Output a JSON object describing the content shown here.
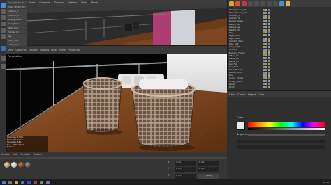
{
  "app": {
    "name": "CINEMA 4D"
  },
  "viewport_top": {
    "tabs": [
      "View",
      "Cameras",
      "Display",
      "Options",
      "Filter",
      "Panel"
    ]
  },
  "mid_toolbar": {
    "items": [
      "View",
      "Cameras",
      "Display",
      "Options",
      "Filter",
      "Panel",
      "ProRender"
    ]
  },
  "render_view": {
    "label": "Perspective"
  },
  "status_overlay": {
    "lines": [
      "Progress: 100%",
      "Time: 00:02:15",
      "Samples: 512",
      "Res: 1920x1080",
      "Frame 0"
    ]
  },
  "object_manager": {
    "toolbar_colors": [
      "#d6a03c",
      "#d45a2a",
      "#c23b3b",
      "#8a8a8a",
      "#4a8fd6"
    ],
    "rows": [
      "Chair_Wicker_01",
      "Chair_Wicker_02",
      "Cushion_L",
      "Cushion_R",
      "Railing_Glass",
      "Deck_Floor",
      "Table_Low",
      "Planter_01",
      "Sky",
      "Light_Sun",
      "Light_Area",
      "Camera_Main",
      "Wall_Left",
      "Wall_Right",
      "Ground",
      "Balcony_Frame",
      "Pillow_01",
      "Pillow_02",
      "Pillow_03",
      "Rail_Top",
      "Rail_Post",
      "Floor_Boards",
      "Background",
      "Env",
      "Group_Chairs",
      "Group_Deco",
      "Lamp",
      "HDRI"
    ]
  },
  "attributes": {
    "tabs": [
      "Basic",
      "Coord.",
      "Object",
      "Color"
    ],
    "color_label": "Color",
    "brightness_label": "Brightness",
    "swatch_color": "#e8e8e8"
  },
  "bottom_panel": {
    "menu": [
      "Create",
      "Edit",
      "Function",
      "Texture"
    ],
    "coord_labels": [
      "X",
      "Y",
      "Z"
    ],
    "coord_values": [
      "0 cm",
      "0 cm",
      "0 cm"
    ],
    "apply_label": "Apply"
  },
  "taskbar": {
    "clock": "12:30"
  }
}
